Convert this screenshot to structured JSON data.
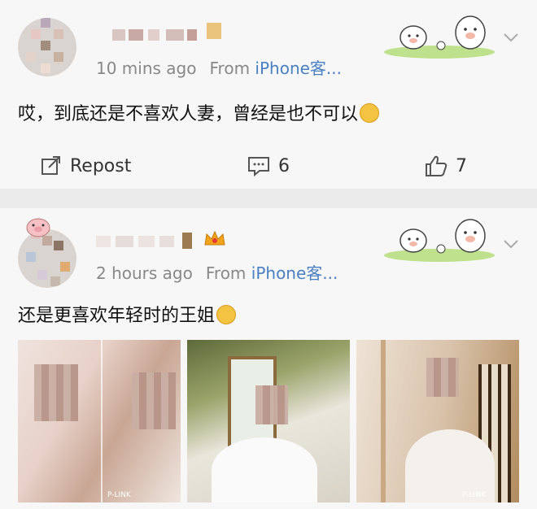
{
  "posts": [
    {
      "time": "10 mins ago",
      "source_prefix": "From",
      "source_app": "iPhone客...",
      "content": "哎，到底还是不喜欢人妻，曾经是也不可以",
      "repost_label": "Repost",
      "comment_count": "6",
      "like_count": "7"
    },
    {
      "time": "2 hours ago",
      "source_prefix": "From",
      "source_app": "iPhone客...",
      "content": "还是更喜欢年轻时的王姐",
      "photos": [
        {
          "watermark": "P-LINK"
        },
        {
          "watermark": ""
        },
        {
          "watermark": "P-LINK"
        }
      ]
    }
  ],
  "colors": {
    "link": "#4a7fc2",
    "meta": "#888888",
    "card": "#f7f7f7",
    "separator": "#ebebeb"
  }
}
